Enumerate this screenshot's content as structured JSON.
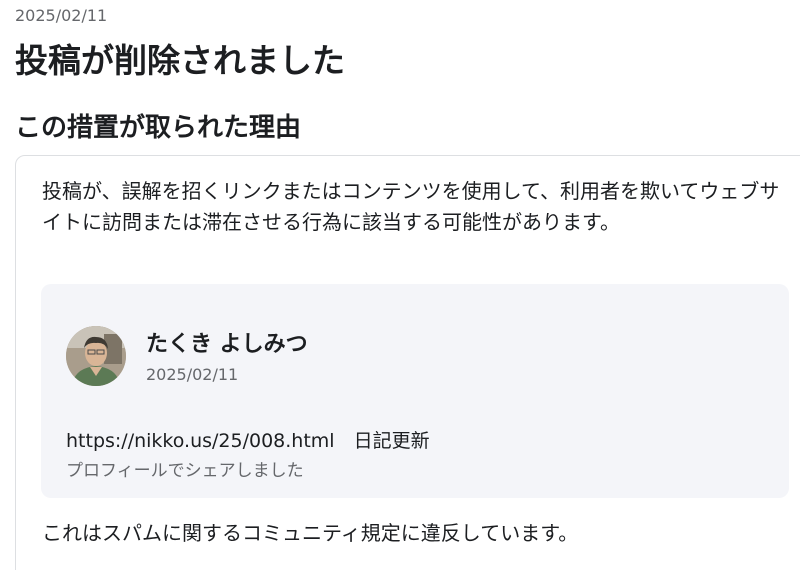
{
  "header": {
    "date": "2025/02/11",
    "title": "投稿が削除されました"
  },
  "section": {
    "title": "この措置が取られた理由"
  },
  "card": {
    "reason": "投稿が、誤解を招くリンクまたはコンテンツを使用して、利用者を欺いてウェブサイトに訪問または滞在させる行為に該当する可能性があります。",
    "post": {
      "author": "たくき よしみつ",
      "date": "2025/02/11",
      "text": "https://nikko.us/25/008.html　日記更新",
      "share_note": "プロフィールでシェアしました",
      "avatar_icon": "user-avatar-photo"
    },
    "policy": "これはスパムに関するコミュニティ規定に違反しています。"
  }
}
